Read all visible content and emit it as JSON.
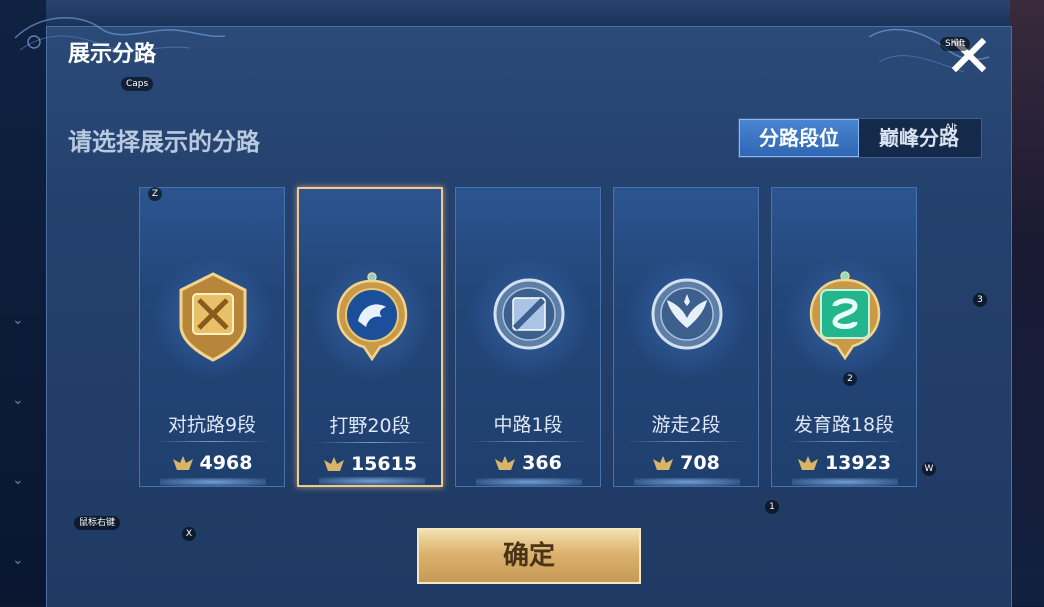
{
  "dialog": {
    "title": "展示分路",
    "subtitle": "请选择展示的分路",
    "close_icon": "close-icon"
  },
  "tabs": [
    {
      "label": "分路段位",
      "active": true
    },
    {
      "label": "巅峰分路",
      "active": false
    }
  ],
  "roles": [
    {
      "name": "对抗路9段",
      "points": "4968",
      "emblem": "clash-lane-gold-icon",
      "selected": false,
      "color": "#d7a94a"
    },
    {
      "name": "打野20段",
      "points": "15615",
      "emblem": "jungle-dragon-gold-icon",
      "selected": true,
      "color": "#2f6fc8"
    },
    {
      "name": "中路1段",
      "points": "366",
      "emblem": "mid-lane-silver-icon",
      "selected": false,
      "color": "#6f8fb6"
    },
    {
      "name": "游走2段",
      "points": "708",
      "emblem": "roam-wing-silver-icon",
      "selected": false,
      "color": "#7d9cc2"
    },
    {
      "name": "发育路18段",
      "points": "13923",
      "emblem": "farm-lane-gold-icon",
      "selected": false,
      "color": "#2fc6a0"
    }
  ],
  "confirm_label": "确定",
  "key_hints": {
    "shift": "Shift",
    "caps": "Caps",
    "alt": "Alt",
    "z": "Z",
    "x": "X",
    "w": "W",
    "n1": "1",
    "n2": "2",
    "n3": "3",
    "mouse_right": "鼠标右键"
  }
}
